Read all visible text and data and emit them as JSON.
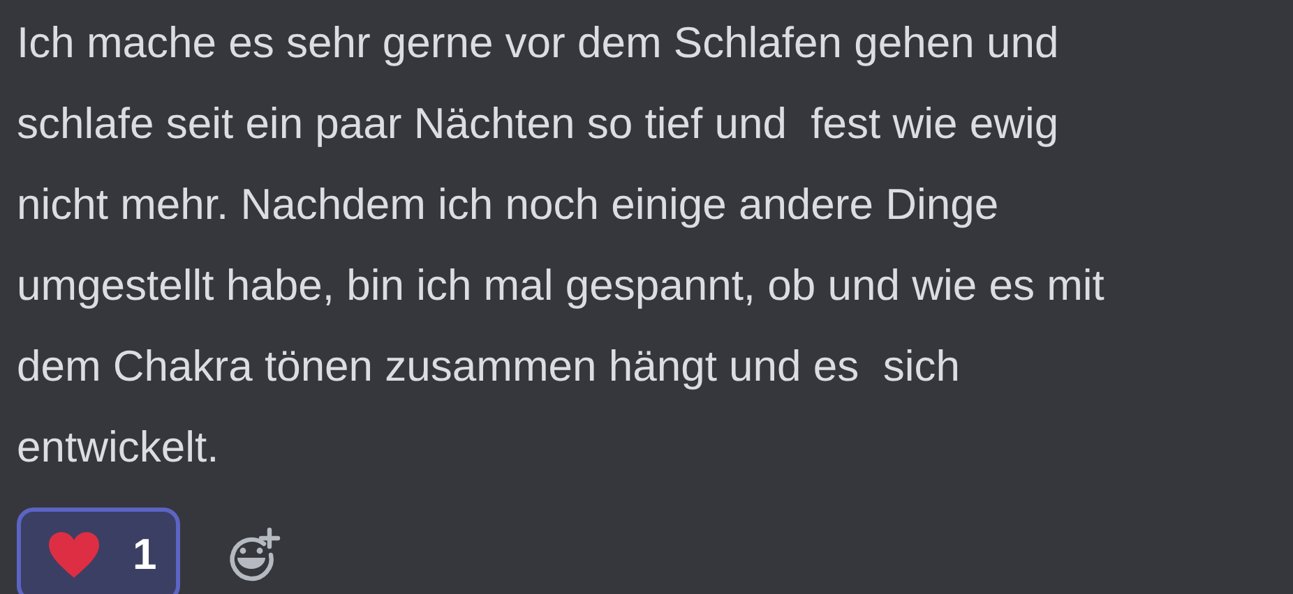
{
  "message": {
    "lines": [
      "Ich mache es sehr gerne vor dem Schlafen gehen und",
      "schlafe seit ein paar Nächten so tief und  fest wie ewig",
      "nicht mehr. Nachdem ich noch einige andere Dinge",
      "umgestellt habe, bin ich mal gespannt, ob und wie es mit",
      "dem Chakra tönen zusammen hängt und es  sich",
      "entwickelt."
    ]
  },
  "reactions": [
    {
      "count": "1",
      "selected": true
    }
  ]
}
